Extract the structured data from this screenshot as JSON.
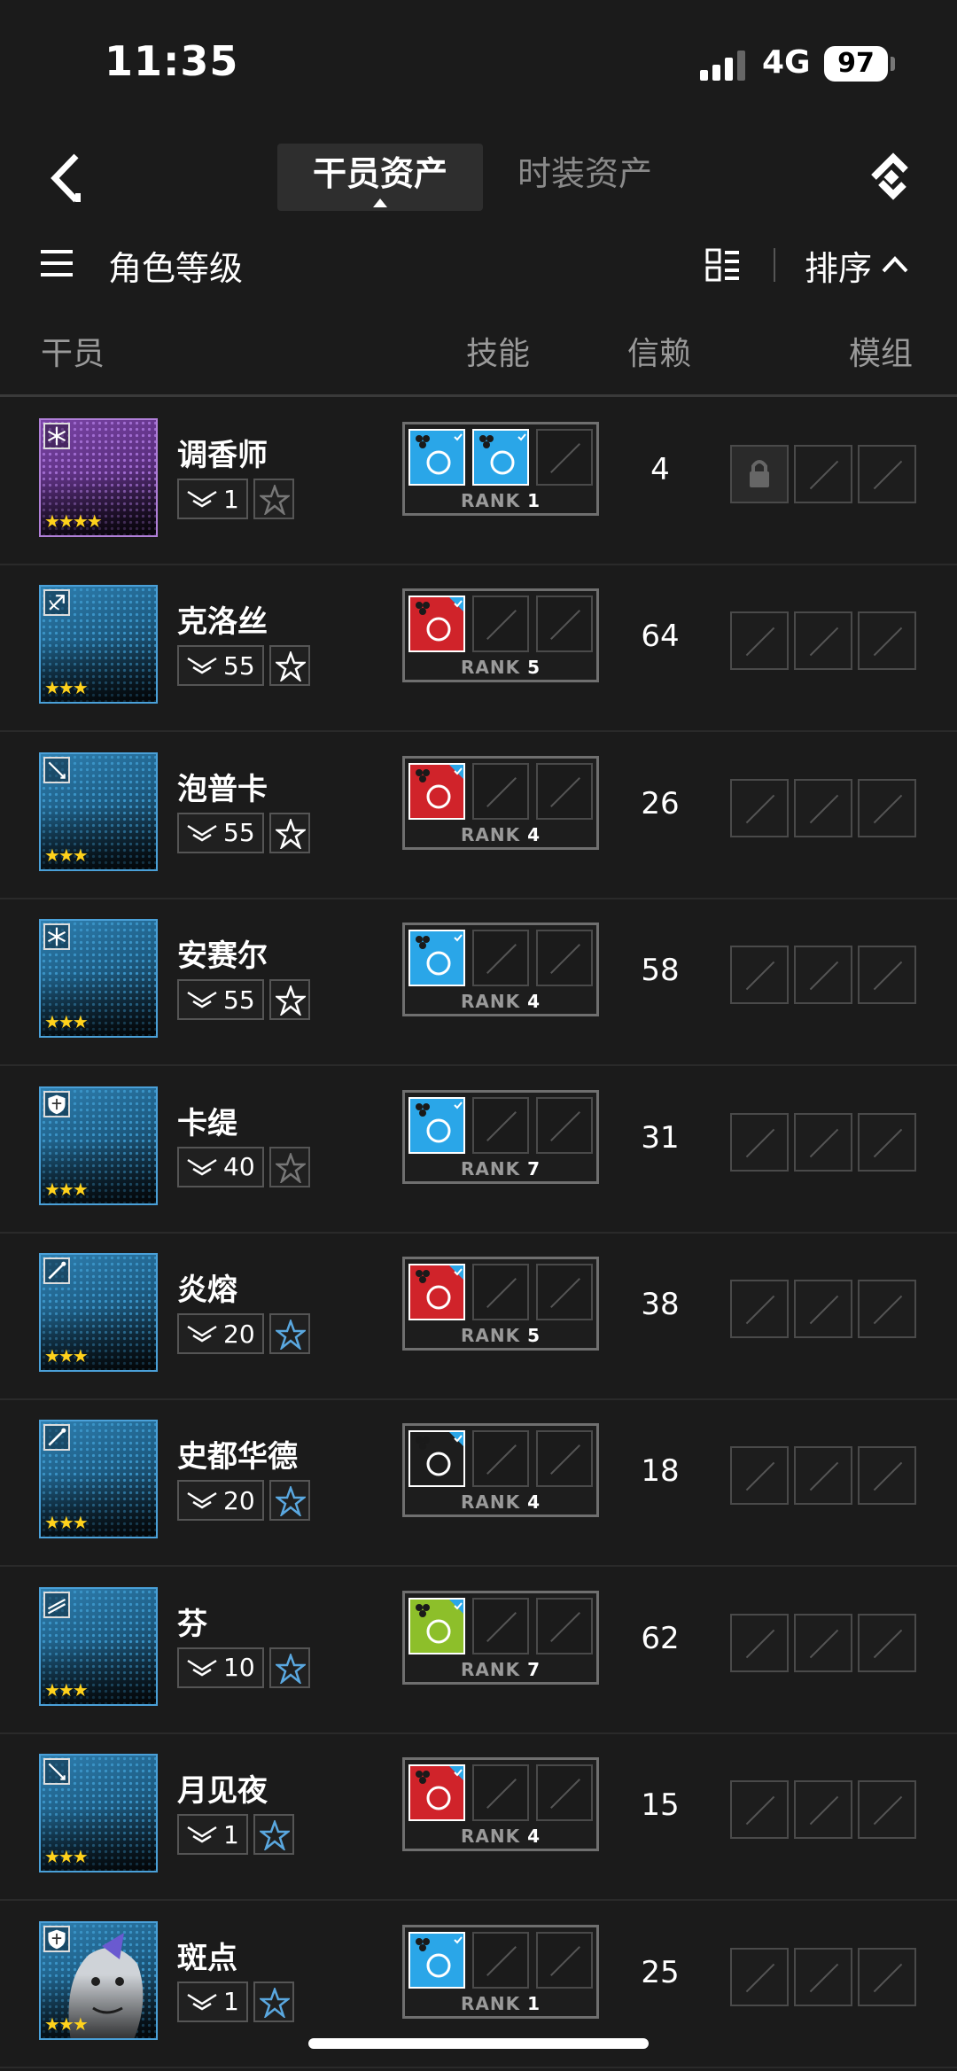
{
  "status_bar": {
    "time": "11:35",
    "network": "4G",
    "battery": "97"
  },
  "tabs": [
    {
      "label": "干员资产",
      "active": true
    },
    {
      "label": "时装资产",
      "active": false
    }
  ],
  "toolbar": {
    "title": "角色等级",
    "sort_label": "排序"
  },
  "columns": {
    "operator": "干员",
    "skills": "技能",
    "trust": "信赖",
    "modules": "模组"
  },
  "rank_word": "RANK",
  "colors": {
    "accent_blue": "#2aa6e8",
    "red_skill": "#d0232a",
    "green_skill": "#8dbf2a",
    "star": "#ffd21c"
  },
  "operators": [
    {
      "name": "调香师",
      "stars": "★★★★",
      "elite_level": "1",
      "class_icon": "snowflake-icon",
      "skills_filled": 2,
      "skill_colors": [
        "#2aa6e8",
        "#2aa6e8"
      ],
      "rank": "1",
      "trust": "4",
      "module_locked": true,
      "rarity": "six"
    },
    {
      "name": "克洛丝",
      "stars": "★★★",
      "elite_level": "55",
      "class_icon": "bow-icon",
      "skills_filled": 1,
      "skill_colors": [
        "#d0232a"
      ],
      "rank": "5",
      "trust": "64",
      "module_locked": false,
      "rarity": "blue"
    },
    {
      "name": "泡普卡",
      "stars": "★★★",
      "elite_level": "55",
      "class_icon": "sword-icon",
      "skills_filled": 1,
      "skill_colors": [
        "#d0232a"
      ],
      "rank": "4",
      "trust": "26",
      "module_locked": false,
      "rarity": "blue"
    },
    {
      "name": "安赛尔",
      "stars": "★★★",
      "elite_level": "55",
      "class_icon": "snowflake-icon",
      "skills_filled": 1,
      "skill_colors": [
        "#2aa6e8"
      ],
      "rank": "4",
      "trust": "58",
      "module_locked": false,
      "rarity": "blue"
    },
    {
      "name": "卡缇",
      "stars": "★★★",
      "elite_level": "40",
      "class_icon": "shield-icon",
      "skills_filled": 1,
      "skill_colors": [
        "#2aa6e8"
      ],
      "rank": "7",
      "trust": "31",
      "module_locked": false,
      "rarity": "blue"
    },
    {
      "name": "炎熔",
      "stars": "★★★",
      "elite_level": "20",
      "class_icon": "wand-icon",
      "skills_filled": 1,
      "skill_colors": [
        "#d0232a"
      ],
      "rank": "5",
      "trust": "38",
      "module_locked": false,
      "rarity": "blue"
    },
    {
      "name": "史都华德",
      "stars": "★★★",
      "elite_level": "20",
      "class_icon": "wand-icon",
      "skills_filled": 1,
      "skill_colors": [
        "#1d1d1d"
      ],
      "rank": "4",
      "trust": "18",
      "module_locked": false,
      "rarity": "blue"
    },
    {
      "name": "芬",
      "stars": "★★★",
      "elite_level": "10",
      "class_icon": "flag-icon",
      "skills_filled": 1,
      "skill_colors": [
        "#8dbf2a"
      ],
      "rank": "7",
      "trust": "62",
      "module_locked": false,
      "rarity": "blue"
    },
    {
      "name": "月见夜",
      "stars": "★★★",
      "elite_level": "1",
      "class_icon": "sword-icon",
      "skills_filled": 1,
      "skill_colors": [
        "#d0232a"
      ],
      "rank": "4",
      "trust": "15",
      "module_locked": false,
      "rarity": "blue"
    },
    {
      "name": "斑点",
      "stars": "★★★",
      "elite_level": "1",
      "class_icon": "shield-icon",
      "skills_filled": 1,
      "skill_colors": [
        "#2aa6e8"
      ],
      "rank": "1",
      "trust": "25",
      "module_locked": false,
      "rarity": "blue"
    }
  ]
}
